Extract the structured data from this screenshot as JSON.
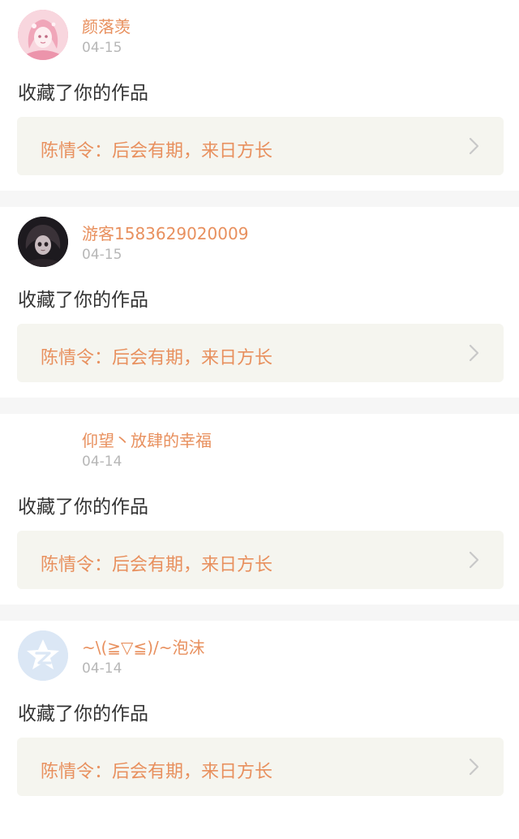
{
  "notifications": [
    {
      "username": "颜落羡",
      "date": "04-15",
      "action": "收藏了你的作品",
      "work": "陈情令：后会有期，来日方长",
      "avatar_icon": "anime-girl-pink-avatar-icon"
    },
    {
      "username": "游客1583629020009",
      "date": "04-15",
      "action": "收藏了你的作品",
      "work": "陈情令：后会有期，来日方长",
      "avatar_icon": "dark-doll-avatar-icon"
    },
    {
      "username": "仰望丶放肆的幸福",
      "date": "04-14",
      "action": "收藏了你的作品",
      "work": "陈情令：后会有期，来日方长",
      "avatar_icon": "blank-avatar-icon"
    },
    {
      "username": "~\\(≧▽≦)/~泡沫",
      "date": "04-14",
      "action": "收藏了你的作品",
      "work": "陈情令：后会有期，来日方长",
      "avatar_icon": "qzone-star-avatar-icon"
    }
  ],
  "colors": {
    "accent": "#e8905e",
    "date": "#b7b7b7",
    "action_text": "#333333",
    "work_box_bg": "#f5f5ef",
    "separator": "#f6f6f6",
    "chevron": "#c8c8c8"
  }
}
